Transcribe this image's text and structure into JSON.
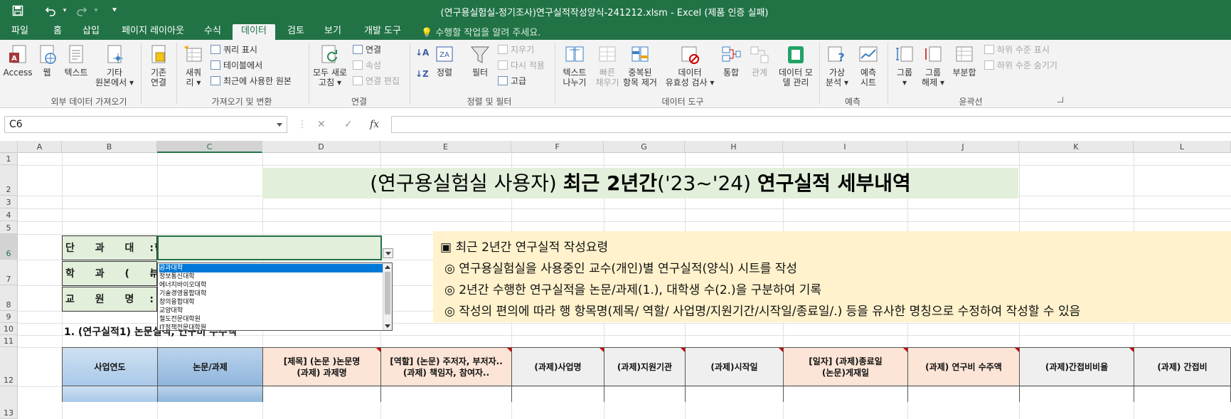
{
  "window": {
    "title": "(연구용실험실-정기조사)연구실적작성양식-241212.xlsm - Excel (제품 인증 실패)",
    "quick_access": {
      "save_icon": "save-icon",
      "undo_icon": "undo-icon",
      "redo_icon": "redo-icon",
      "customize_icon": "customize-icon"
    }
  },
  "tabs": [
    "파일",
    "홈",
    "삽입",
    "페이지 레이아웃",
    "수식",
    "데이터",
    "검토",
    "보기",
    "개발 도구"
  ],
  "active_tab": "데이터",
  "tell_me": "수행할 작업을 알려 주세요.",
  "ribbon": {
    "groups": [
      "외부 데이터 가져오기",
      "가져오기 및 변환",
      "연결",
      "정렬 및 필터",
      "데이터 도구",
      "예측",
      "윤곽선"
    ],
    "access": "Access",
    "web": "웹",
    "text": "텍스트",
    "other1": "기타",
    "other2": "원본에서",
    "existing1": "기존",
    "existing2": "연결",
    "newq1": "새쿼",
    "newq2": "리",
    "show_query": "쿼리 표시",
    "from_table": "테이블에서",
    "recent_sources": "최근에 사용한 원본",
    "refresh1": "모두 새로",
    "refresh2": "고침",
    "connections": "연결",
    "properties": "속성",
    "edit_links": "연결 편집",
    "sort_az": "정렬",
    "filter": "필터",
    "clear": "지우기",
    "reapply": "다시 적용",
    "advanced": "고급",
    "text_to_cols1": "텍스트",
    "text_to_cols2": "나누기",
    "flash1": "빠른",
    "flash2": "채우기",
    "remove_dup1": "중복된",
    "remove_dup2": "항목 제거",
    "validation1": "데이터",
    "validation2": "유효성 검사",
    "consolidate": "통합",
    "relationships": "관계",
    "datamodel1": "데이터 모",
    "datamodel2": "델 관리",
    "whatif1": "가상",
    "whatif2": "분석",
    "forecast1": "예측",
    "forecast2": "시트",
    "group": "그룹",
    "ungroup1": "그룹",
    "ungroup2": "해제",
    "subtotal": "부분합",
    "show_detail": "하위 수준 표시",
    "hide_detail": "하위 수준 숨기기"
  },
  "formula_bar": {
    "name_box": "C6",
    "cancel": "✕",
    "enter": "✓",
    "fx": "fx",
    "formula": ""
  },
  "columns": [
    "A",
    "B",
    "C",
    "D",
    "E",
    "F",
    "G",
    "H",
    "I",
    "J",
    "K",
    "L"
  ],
  "selected_column": "C",
  "rows": [
    "1",
    "2",
    "3",
    "4",
    "5",
    "6",
    "7",
    "8",
    "9",
    "10",
    "11",
    "12",
    "13"
  ],
  "selected_row": "6",
  "sheet": {
    "title_parts": [
      "(연구용실험실 사용자) ",
      "최근 2년간",
      "('23~'24) ",
      "연구실적 세부내역"
    ],
    "label_college": "단 과 대 학",
    "label_dept": "학 과 ( 부 )",
    "label_prof": "교 원 명",
    "colon": ":",
    "dropdown_items": [
      "공과대학",
      "정보통신대학",
      "에너지바이오대학",
      "기술경영융합대학",
      "창의융합대학",
      "교양대학",
      "철도전문대학원",
      "IT정책전문대학원"
    ],
    "dropdown_selected": "공과대학",
    "guide": {
      "heading": "▣ 최근 2년간 연구실적 작성요령",
      "lines": [
        "◎ 연구용실험실을 사용중인 교수(개인)별 연구실적(양식) 시트를 작성",
        "◎ 2년간 수행한 연구실적을 논문/과제(1.), 대학생 수(2.)을 구분하여 기록",
        "◎  작성의 편의에 따라 행 항목명(제목/ 역할/ 사업명/지원기간/시작일/종료일/.) 등을 유사한 명칭으로 수정하여 작성할 수 있음"
      ]
    },
    "section1": "1. (연구실적1) 논문실적,  연구비 수주액",
    "headers": [
      "사업연도",
      "논문/과제",
      "[제목] (논문 )논문명\n(과제) 과제명",
      "[역할] (논문) 주저자, 부저자..\n(과제) 책임자, 참여자..",
      "(과제)사업명",
      "(과제)지원기관",
      "(과제)시작일",
      "[일자] (과제)종료일\n(논문)게재일",
      "(과제) 연구비 수주액",
      "(과제)간접비비율",
      "(과제) 간접비"
    ]
  },
  "colors": {
    "excel_green": "#217346",
    "title_fill": "#e2efda",
    "guide_fill": "#fff2cc",
    "header_blue": "#bdd7ee",
    "header_pink": "#fce4d6",
    "selection_blue": "#0078d7"
  }
}
